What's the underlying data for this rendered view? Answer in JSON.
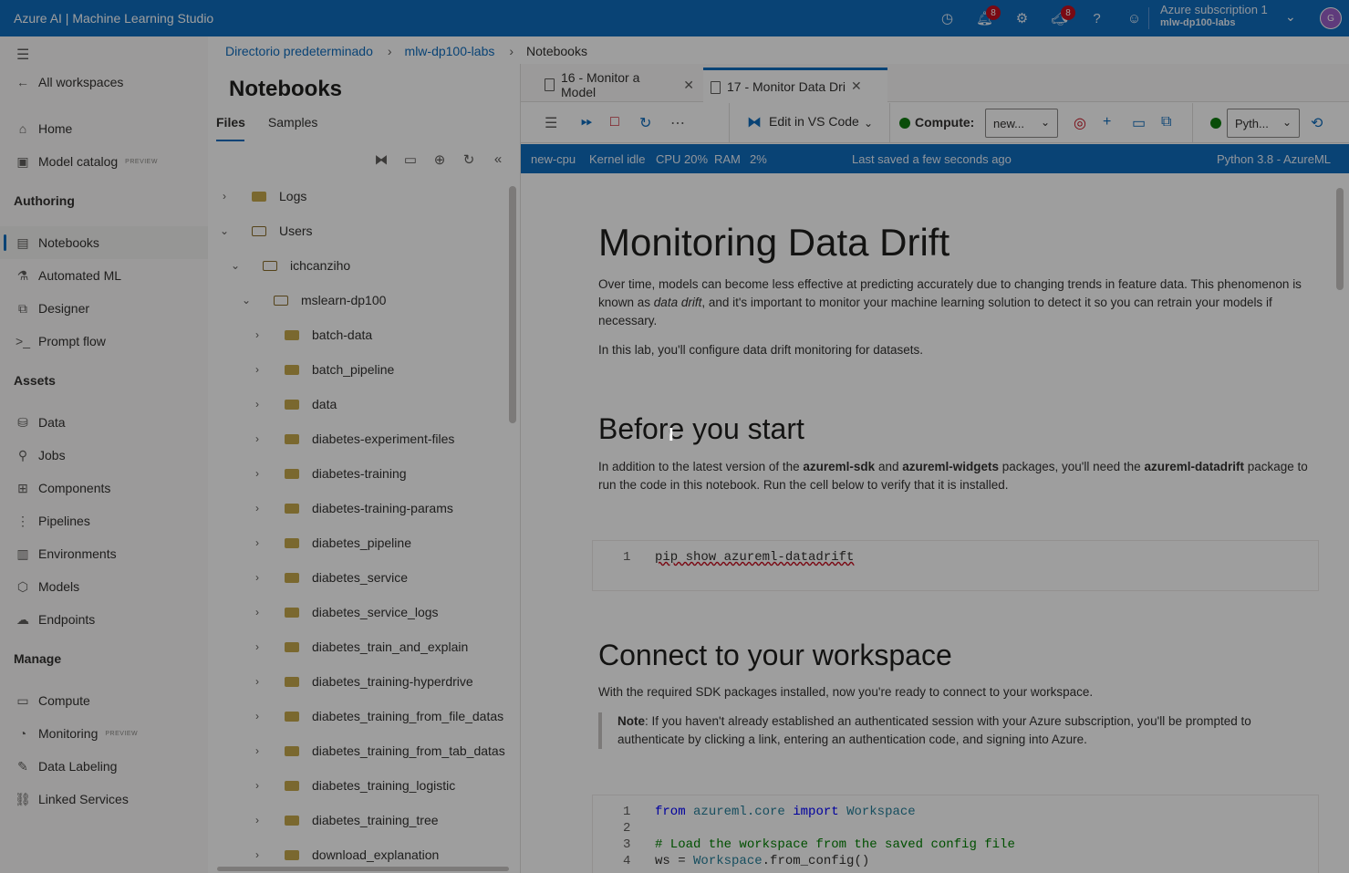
{
  "app": {
    "title": "Azure AI | Machine Learning Studio"
  },
  "topbar": {
    "notification_badge": "8",
    "feedback_badge": "8",
    "subscription": "Azure subscription 1",
    "workspace": "mlw-dp100-labs",
    "avatar_initial": "G",
    "icons": [
      "history-icon",
      "bell-icon",
      "gear-icon",
      "megaphone-icon",
      "help-icon",
      "smiley-icon"
    ]
  },
  "leftnav": {
    "all_workspaces": "All workspaces",
    "home": "Home",
    "model_catalog": "Model catalog",
    "preview": "PREVIEW",
    "sections": {
      "authoring": "Authoring",
      "assets": "Assets",
      "manage": "Manage"
    },
    "authoring": [
      "Notebooks",
      "Automated ML",
      "Designer",
      "Prompt flow"
    ],
    "assets": [
      "Data",
      "Jobs",
      "Components",
      "Pipelines",
      "Environments",
      "Models",
      "Endpoints"
    ],
    "manage": [
      "Compute",
      "Monitoring",
      "Data Labeling",
      "Linked Services"
    ]
  },
  "breadcrumb": [
    "Directorio predeterminado",
    "mlw-dp100-labs",
    "Notebooks"
  ],
  "files": {
    "title": "Notebooks",
    "tabs": [
      "Files",
      "Samples"
    ],
    "tree": [
      "Logs",
      "Users",
      "ichcanziho",
      "mslearn-dp100",
      "batch-data",
      "batch_pipeline",
      "data",
      "diabetes-experiment-files",
      "diabetes-training",
      "diabetes-training-params",
      "diabetes_pipeline",
      "diabetes_service",
      "diabetes_service_logs",
      "diabetes_train_and_explain",
      "diabetes_training-hyperdrive",
      "diabetes_training_from_file_datas",
      "diabetes_training_from_tab_datas",
      "diabetes_training_logistic",
      "diabetes_training_tree",
      "download_explanation"
    ]
  },
  "notebook": {
    "tabs": [
      "16 - Monitor a Model",
      "17 - Monitor Data Dri"
    ],
    "toolbar": {
      "edit_vs_code": "Edit in VS Code",
      "compute_label": "Compute:",
      "compute_value": "new...",
      "kernel_value": "Pyth..."
    },
    "status": {
      "compute": "new-cpu",
      "kernel": "Kernel idle",
      "cpu": "CPU 20%",
      "ram": "RAM",
      "ram_value": "2%",
      "saved": "Last saved a few seconds ago",
      "runtime": "Python 3.8 - AzureML"
    },
    "h1": "Monitoring Data Drift",
    "intro_p1a": "Over time, models can become less effective at predicting accurately due to changing trends in feature data. This phenomenon is known as ",
    "intro_p1_em": "data drift",
    "intro_p1b": ", and it's important to monitor your machine learning solution to detect it so you can retrain your models if necessary.",
    "intro_p2": "In this lab, you'll configure data drift monitoring for datasets.",
    "h2_before": "Before you start",
    "before_a": "In addition to the latest version of the ",
    "before_b1": "azureml-sdk",
    "before_and": " and ",
    "before_b2": "azureml-widgets",
    "before_c": " packages, you'll need the ",
    "before_b3": "azureml-datadrift",
    "before_d": " package to run the code in this notebook. Run the cell below to verify that it is installed.",
    "cell1": {
      "line": "1",
      "code": "pip show azureml-datadrift"
    },
    "h2_connect": "Connect to your workspace",
    "connect_p": "With the required SDK packages installed, now you're ready to connect to your workspace.",
    "note_label": "Note",
    "note_text": ": If you haven't already established an authenticated session with your Azure subscription, you'll be prompted to authenticate by clicking a link, entering an authentication code, and signing into Azure.",
    "cell2": {
      "lines": [
        "1",
        "2",
        "3",
        "4"
      ],
      "l1_kw1": "from",
      "l1_mod": "azureml.core",
      "l1_kw2": "import",
      "l1_cls": "Workspace",
      "l3": "# Load the workspace from the saved config file",
      "l4a": "ws = ",
      "l4_cls": "Workspace",
      "l4b": ".from_config()"
    }
  }
}
